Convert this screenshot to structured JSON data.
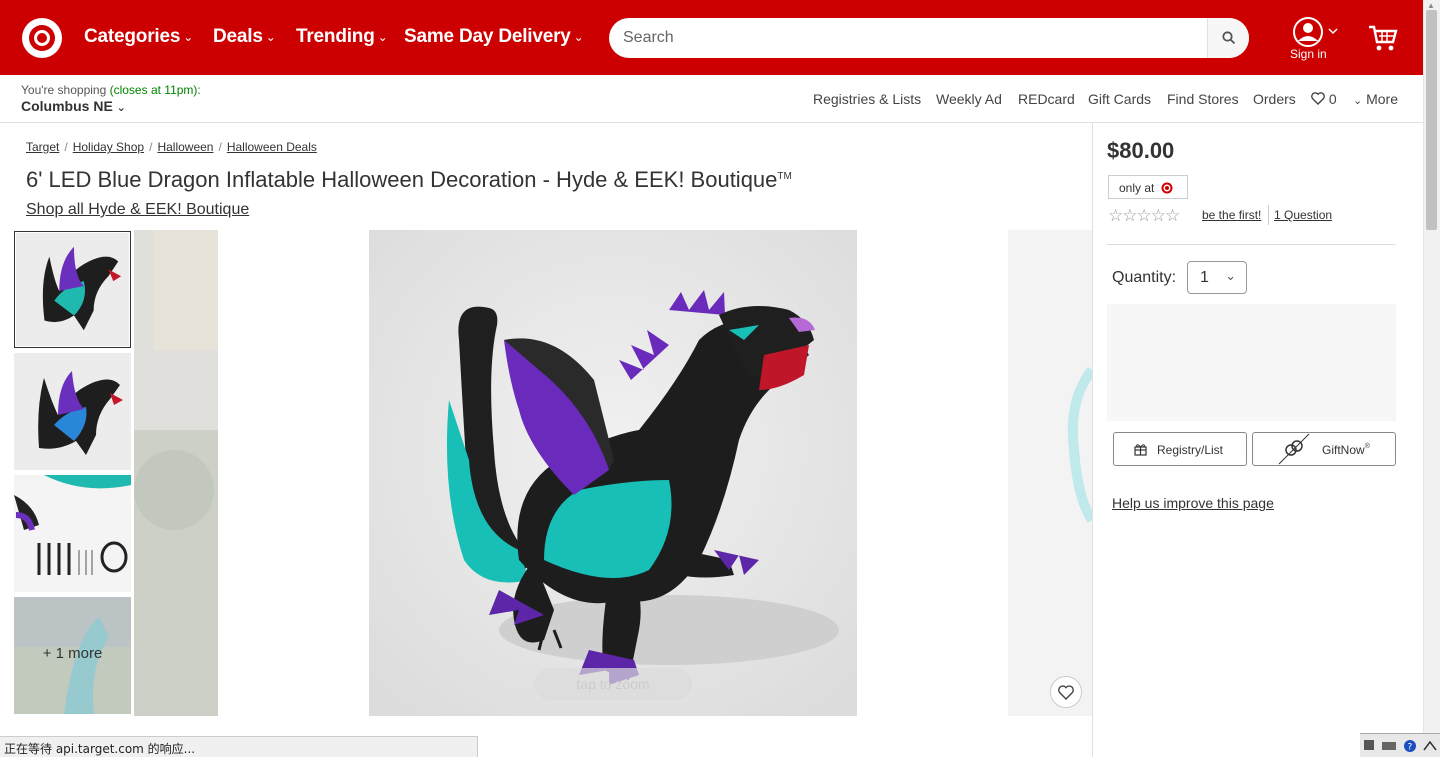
{
  "header": {
    "nav": [
      {
        "label": "Categories"
      },
      {
        "label": "Deals"
      },
      {
        "label": "Trending"
      },
      {
        "label": "Same Day Delivery"
      }
    ],
    "chevron": "⌄",
    "search_placeholder": "Search",
    "sign_in": "Sign in",
    "brand_color": "#cc0000"
  },
  "subbar": {
    "shopping_prefix": "You're shopping ",
    "shopping_hours": "(closes at 11pm)",
    "shopping_suffix": ":",
    "store": "Columbus NE",
    "links": [
      "Registries & Lists",
      "Weekly Ad",
      "REDcard",
      "Gift Cards",
      "Find Stores",
      "Orders"
    ],
    "favorites_count": "0",
    "more": "More"
  },
  "breadcrumbs": [
    "Target",
    "Holiday Shop",
    "Halloween",
    "Halloween Deals"
  ],
  "product": {
    "title": "6' LED Blue Dragon Inflatable Halloween Decoration - Hyde & EEK! Boutique",
    "trademark": "TM",
    "shop_all": "Shop all Hyde & EEK! Boutique",
    "more_images": "+ 1 more",
    "tap_zoom": "tap to zoom",
    "price": "$80.00",
    "only_at": "only at",
    "stars": "☆☆☆☆☆",
    "be_first": "be the first!",
    "question": "1 Question",
    "quantity_label": "Quantity:",
    "quantity_value": "1",
    "registry_btn": "Registry/List",
    "giftnow_btn": "GiftNow",
    "giftnow_mark": "®",
    "help_link": "Help us improve this page"
  },
  "status_bar": "正在等待 api.target.com 的响应..."
}
